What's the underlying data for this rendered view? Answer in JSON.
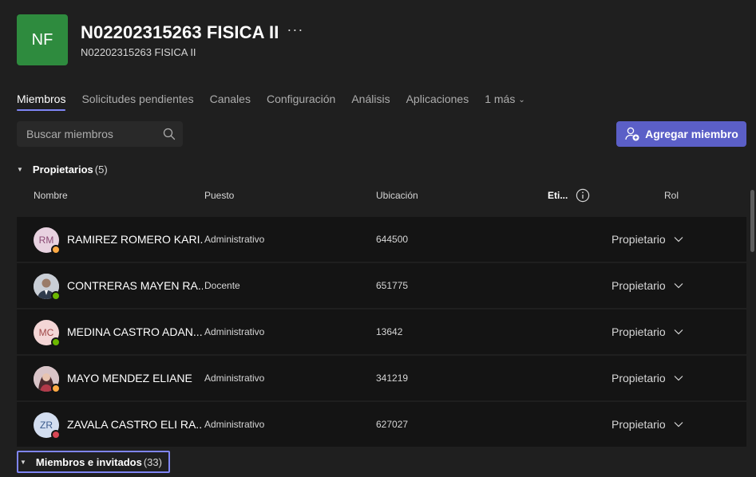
{
  "team": {
    "initials": "NF",
    "avatar_color": "#2e8b3e",
    "name": "N02202315263 FISICA II",
    "more": "···",
    "subtitle": "N02202315263 FISICA II"
  },
  "tabs": [
    {
      "label": "Miembros",
      "active": true
    },
    {
      "label": "Solicitudes pendientes"
    },
    {
      "label": "Canales"
    },
    {
      "label": "Configuración"
    },
    {
      "label": "Análisis"
    },
    {
      "label": "Aplicaciones"
    },
    {
      "label": "1 más"
    }
  ],
  "search": {
    "placeholder": "Buscar miembros",
    "icon": "search-icon"
  },
  "add_member": {
    "label": "Agregar miembro",
    "icon": "person-add-icon",
    "color": "#5b5fc7"
  },
  "owners_section": {
    "label": "Propietarios",
    "count": "(5)"
  },
  "members_section": {
    "label": "Miembros e invitados",
    "count": "(33)"
  },
  "columns": {
    "nombre": "Nombre",
    "puesto": "Puesto",
    "ubicacion": "Ubicación",
    "etiquetas": "Eti...",
    "rol": "Rol"
  },
  "owners": [
    {
      "initials": "RM",
      "avatar_bg": "#e8d2e0",
      "avatar_fg": "#8a4a74",
      "presence": "away",
      "name": "RAMIREZ ROMERO KARI...",
      "puesto": "Administrativo",
      "ubicacion": "644500",
      "rol": "Propietario"
    },
    {
      "initials": "",
      "avatar_bg": "#5a6f8a",
      "avatar_fg": "#ffffff",
      "presence": "available",
      "name": "CONTRERAS MAYEN RA...",
      "puesto": "Docente",
      "ubicacion": "651775",
      "rol": "Propietario"
    },
    {
      "initials": "MC",
      "avatar_bg": "#f4d6d6",
      "avatar_fg": "#a04848",
      "presence": "available",
      "name": "MEDINA CASTRO ADAN...",
      "puesto": "Administrativo",
      "ubicacion": "13642",
      "rol": "Propietario"
    },
    {
      "initials": "",
      "avatar_bg": "#b23a4a",
      "avatar_fg": "#ffffff",
      "presence": "away",
      "name": "MAYO MENDEZ ELIANE",
      "puesto": "Administrativo",
      "ubicacion": "341219",
      "rol": "Propietario"
    },
    {
      "initials": "ZR",
      "avatar_bg": "#d3def0",
      "avatar_fg": "#3a5a8c",
      "presence": "busy",
      "name": "ZAVALA CASTRO ELI RA...",
      "puesto": "Administrativo",
      "ubicacion": "627027",
      "rol": "Propietario"
    }
  ],
  "presence_colors": {
    "available": "#6bb700",
    "away": "#ffaa44",
    "busy": "#d74654"
  }
}
